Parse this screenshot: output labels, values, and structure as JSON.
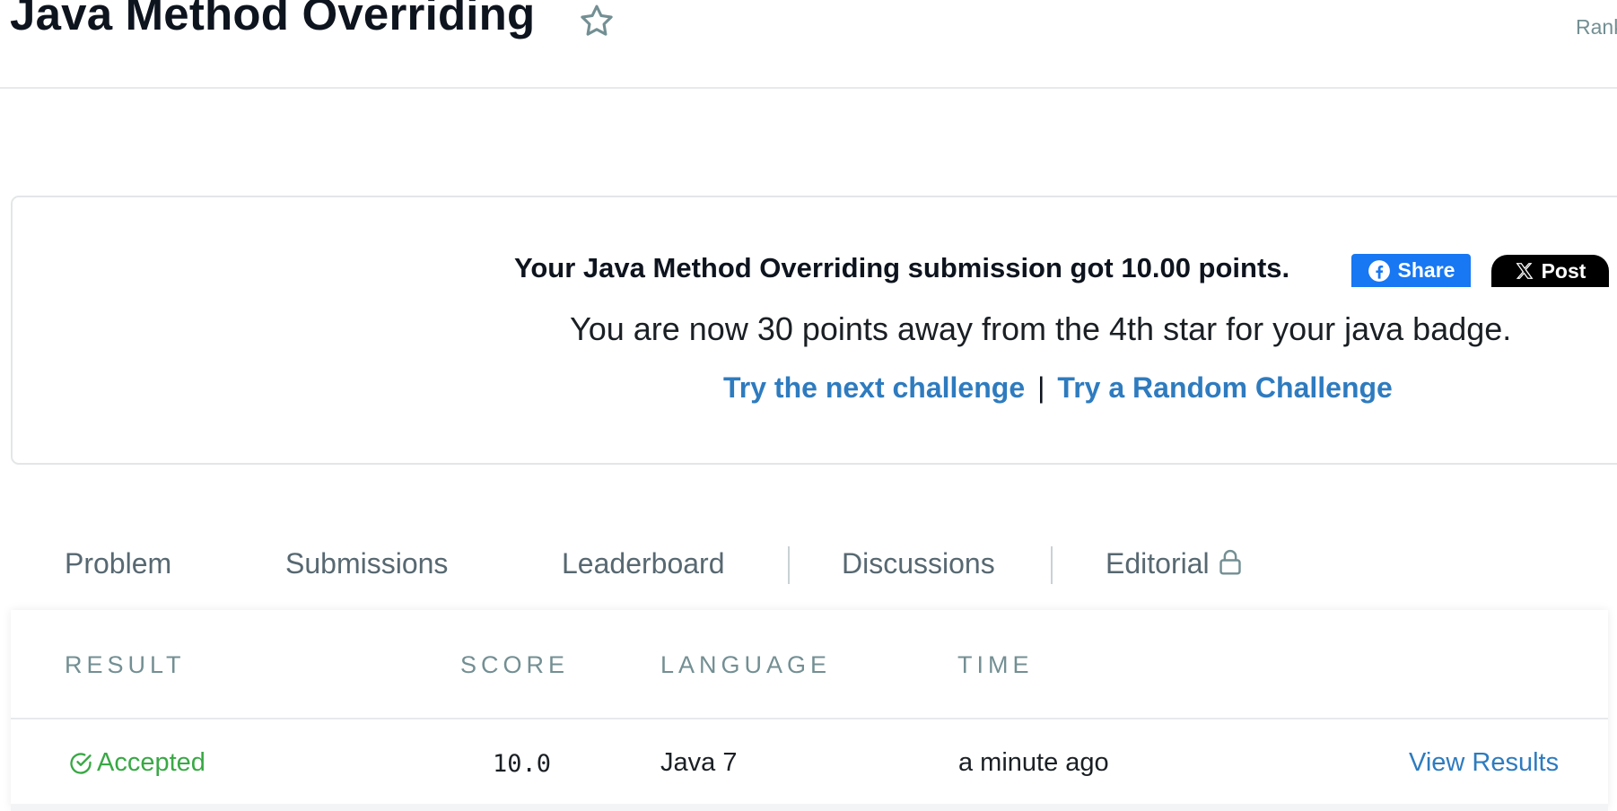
{
  "header": {
    "title": "Java Method Overriding",
    "rank_label": "Rank"
  },
  "card": {
    "submission_message": "Your Java Method Overriding submission got 10.00 points.",
    "facebook_share_label": "Share",
    "x_post_label": "Post",
    "away_message": "You are now 30 points away from the 4th star for your java badge.",
    "next_challenge_label": "Try the next challenge",
    "separator": "|",
    "random_challenge_label": "Try a Random Challenge"
  },
  "tabs": [
    {
      "label": "Problem"
    },
    {
      "label": "Submissions",
      "active": true
    },
    {
      "label": "Leaderboard"
    },
    {
      "label": "Discussions"
    },
    {
      "label": "Editorial",
      "locked": true
    }
  ],
  "table": {
    "columns": [
      "RESULT",
      "SCORE",
      "LANGUAGE",
      "TIME"
    ],
    "rows": [
      {
        "result": "Accepted",
        "score": "10.0",
        "language": "Java 7",
        "time": "a minute ago",
        "action": "View Results"
      }
    ]
  },
  "colors": {
    "accent_link": "#2e7bbf",
    "success": "#39a845",
    "facebook": "#1877f2",
    "x": "#000000"
  },
  "icons": [
    "star-icon",
    "facebook-icon",
    "x-logo-icon",
    "lock-icon",
    "check-circle-icon"
  ]
}
